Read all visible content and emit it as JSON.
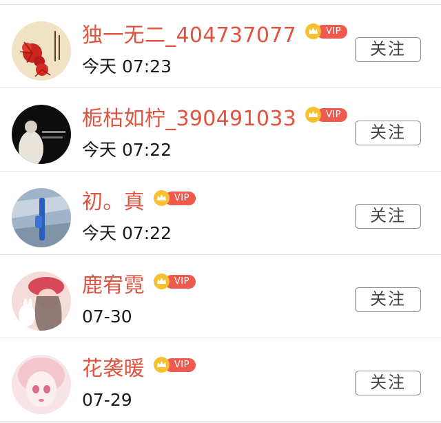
{
  "colors": {
    "name": "#e0533f",
    "vip_badge": "#ef5a4e",
    "crown": "#f6c12d",
    "divider": "#e4e4e4"
  },
  "follow_list": [
    {
      "name": "独一无二_404737077",
      "vip_label": "VIP",
      "time": "今天 07:23",
      "follow_label": "关注"
    },
    {
      "name": "栀枯如柠_390491033",
      "vip_label": "VIP",
      "time": "今天 07:22",
      "follow_label": "关注"
    },
    {
      "name": "初。真",
      "vip_label": "VIP",
      "time": "今天 07:22",
      "follow_label": "关注"
    },
    {
      "name": "鹿宥霓",
      "vip_label": "VIP",
      "time": "07-30",
      "follow_label": "关注"
    },
    {
      "name": "花袭暖",
      "vip_label": "VIP",
      "time": "07-29",
      "follow_label": "关注"
    }
  ]
}
